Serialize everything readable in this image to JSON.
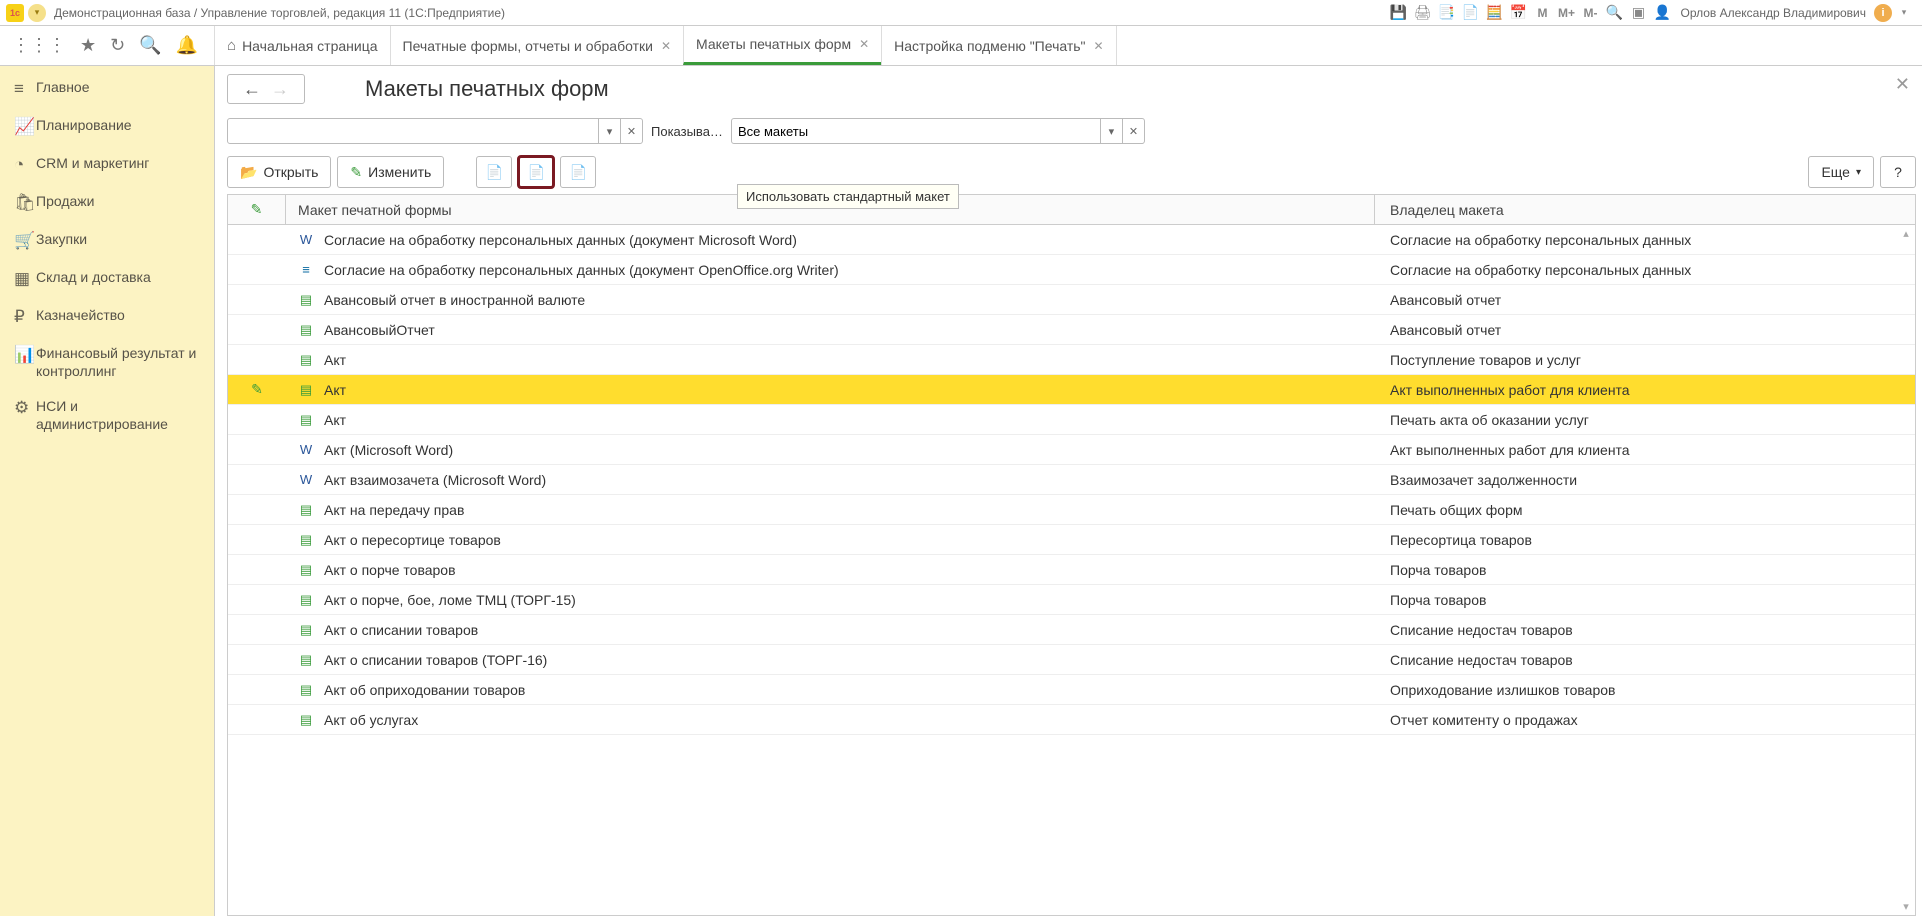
{
  "title_bar": {
    "logo_text": "1c",
    "app_title": "Демонстрационная база / Управление торговлей, редакция 11  (1С:Предприятие)",
    "m1": "M",
    "m2": "M+",
    "m3": "M-",
    "user_name": "Орлов Александр Владимирович"
  },
  "tabs": {
    "home": "Начальная страница",
    "t1": "Печатные формы, отчеты и обработки",
    "t2": "Макеты печатных форм",
    "t3": "Настройка подменю \"Печать\""
  },
  "sidebar": {
    "items": [
      {
        "icon": "≡",
        "label": "Главное"
      },
      {
        "icon": "📈",
        "label": "Планирование"
      },
      {
        "icon": "◔",
        "label": "CRM и маркетинг"
      },
      {
        "icon": "🛍",
        "label": "Продажи"
      },
      {
        "icon": "🛒",
        "label": "Закупки"
      },
      {
        "icon": "▦",
        "label": "Склад и доставка"
      },
      {
        "icon": "₽",
        "label": "Казначейство"
      },
      {
        "icon": "📊",
        "label": "Финансовый результат и контроллинг"
      },
      {
        "icon": "⚙",
        "label": "НСИ и администрирование"
      }
    ]
  },
  "page": {
    "title": "Макеты печатных форм",
    "search_value": "",
    "show_label": "Показыва…",
    "show_value": "Все макеты",
    "btn_open": "Открыть",
    "btn_edit": "Изменить",
    "btn_more": "Еще",
    "tooltip_text": "Использовать стандартный макет",
    "col_name": "Макет печатной формы",
    "col_owner": "Владелец макета"
  },
  "rows": [
    {
      "icon": "word",
      "name": "Согласие на обработку персональных данных (документ Microsoft Word)",
      "owner": "Согласие на обработку персональных данных",
      "status": ""
    },
    {
      "icon": "writer",
      "name": "Согласие на обработку персональных данных (документ OpenOffice.org Writer)",
      "owner": "Согласие на обработку персональных данных",
      "status": ""
    },
    {
      "icon": "mxl",
      "name": "Авансовый отчет в иностранной валюте",
      "owner": "Авансовый отчет",
      "status": ""
    },
    {
      "icon": "mxl",
      "name": "АвансовыйОтчет",
      "owner": "Авансовый отчет",
      "status": ""
    },
    {
      "icon": "mxl",
      "name": "Акт",
      "owner": "Поступление товаров и услуг",
      "status": ""
    },
    {
      "icon": "mxl",
      "name": "Акт",
      "owner": "Акт выполненных работ для клиента",
      "status": "✎",
      "selected": true
    },
    {
      "icon": "mxl",
      "name": "Акт",
      "owner": "Печать акта об оказании услуг",
      "status": ""
    },
    {
      "icon": "word",
      "name": "Акт (Microsoft Word)",
      "owner": "Акт выполненных работ для клиента",
      "status": ""
    },
    {
      "icon": "word",
      "name": "Акт взаимозачета (Microsoft Word)",
      "owner": "Взаимозачет задолженности",
      "status": ""
    },
    {
      "icon": "mxl",
      "name": "Акт на передачу прав",
      "owner": "Печать общих форм",
      "status": ""
    },
    {
      "icon": "mxl",
      "name": "Акт о пересортице товаров",
      "owner": "Пересортица товаров",
      "status": ""
    },
    {
      "icon": "mxl",
      "name": "Акт о порче товаров",
      "owner": "Порча товаров",
      "status": ""
    },
    {
      "icon": "mxl",
      "name": "Акт о порче, бое, ломе ТМЦ (ТОРГ-15)",
      "owner": "Порча товаров",
      "status": ""
    },
    {
      "icon": "mxl",
      "name": "Акт о списании товаров",
      "owner": "Списание недостач товаров",
      "status": ""
    },
    {
      "icon": "mxl",
      "name": "Акт о списании товаров (ТОРГ-16)",
      "owner": "Списание недостач товаров",
      "status": ""
    },
    {
      "icon": "mxl",
      "name": "Акт об оприходовании товаров",
      "owner": "Оприходование излишков товаров",
      "status": ""
    },
    {
      "icon": "mxl",
      "name": "Акт об услугах",
      "owner": "Отчет комитенту о продажах",
      "status": ""
    }
  ]
}
